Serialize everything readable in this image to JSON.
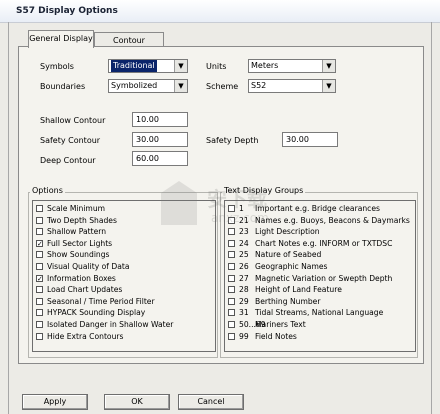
{
  "window": {
    "title": "S57 Display Options"
  },
  "tabs": [
    {
      "label": "General Display"
    },
    {
      "label": "Contour Planning"
    }
  ],
  "settings": {
    "symbols_label": "Symbols",
    "symbols_value": "Traditional",
    "boundaries_label": "Boundaries",
    "boundaries_value": "Symbolized",
    "units_label": "Units",
    "units_value": "Meters",
    "scheme_label": "Scheme",
    "scheme_value": "S52"
  },
  "contours": {
    "shallow_label": "Shallow Contour",
    "shallow_value": "10.00",
    "safety_label": "Safety Contour",
    "safety_value": "30.00",
    "deep_label": "Deep Contour",
    "deep_value": "60.00",
    "safety_depth_label": "Safety Depth",
    "safety_depth_value": "30.00"
  },
  "options": {
    "label": "Options",
    "items": [
      {
        "label": "Scale Minimum",
        "checked": false
      },
      {
        "label": "Two Depth Shades",
        "checked": false
      },
      {
        "label": "Shallow Pattern",
        "checked": false
      },
      {
        "label": "Full Sector Lights",
        "checked": true
      },
      {
        "label": "Show Soundings",
        "checked": false
      },
      {
        "label": "Visual Quality of Data",
        "checked": false
      },
      {
        "label": "Information Boxes",
        "checked": true
      },
      {
        "label": "Load Chart Updates",
        "checked": false
      },
      {
        "label": "Seasonal / Time Period Filter",
        "checked": false
      },
      {
        "label": "HYPACK Sounding Display",
        "checked": false
      },
      {
        "label": "Isolated Danger in Shallow Water",
        "checked": false
      },
      {
        "label": "Hide Extra Contours",
        "checked": false
      }
    ]
  },
  "text_groups": {
    "label": "Text Display Groups",
    "items": [
      {
        "num": "1",
        "label": "Important e.g. Bridge clearances",
        "checked": false
      },
      {
        "num": "21",
        "label": "Names e.g. Buoys, Beacons & Daymarks",
        "checked": false
      },
      {
        "num": "23",
        "label": "Light Description",
        "checked": false
      },
      {
        "num": "24",
        "label": "Chart Notes e.g. INFORM or TXTDSC",
        "checked": false
      },
      {
        "num": "25",
        "label": "Nature of Seabed",
        "checked": false
      },
      {
        "num": "26",
        "label": "Geographic Names",
        "checked": false
      },
      {
        "num": "27",
        "label": "Magnetic Variation or Swepth Depth",
        "checked": false
      },
      {
        "num": "28",
        "label": "Height of Land Feature",
        "checked": false
      },
      {
        "num": "29",
        "label": "Berthing Number",
        "checked": false
      },
      {
        "num": "31",
        "label": "Tidal Streams, National Language",
        "checked": false
      },
      {
        "num": "50...69",
        "label": "Mariners Text",
        "checked": false
      },
      {
        "num": "99",
        "label": "Field Notes",
        "checked": false
      }
    ]
  },
  "buttons": {
    "apply": "Apply",
    "ok": "OK",
    "cancel": "Cancel"
  },
  "watermark": {
    "text": "安下载",
    "subtext": "anxz.com"
  }
}
